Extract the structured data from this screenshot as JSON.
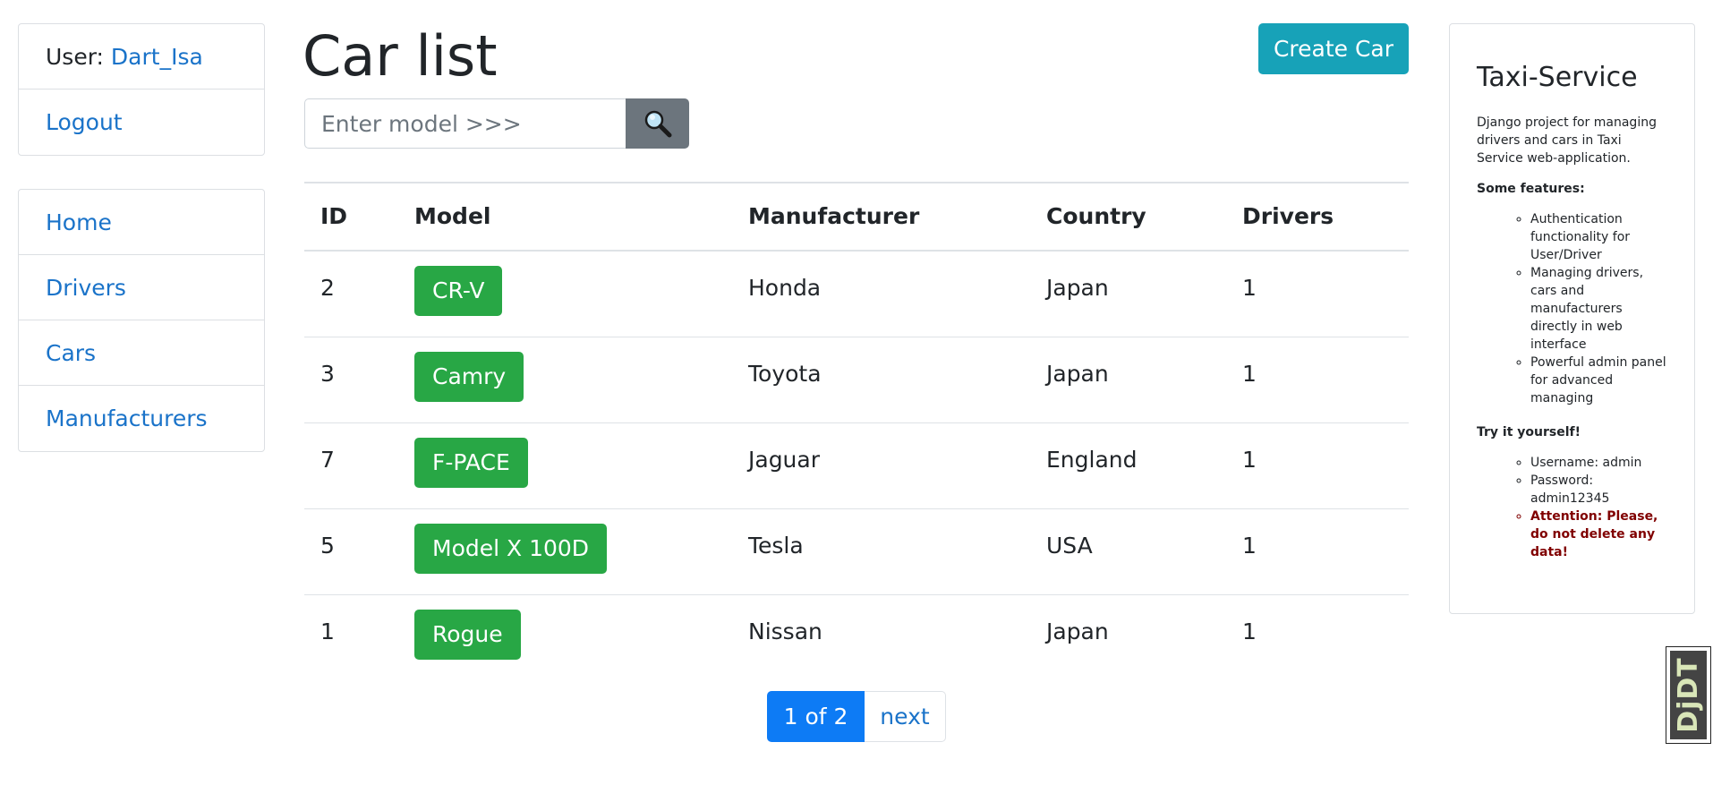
{
  "sidebar": {
    "user_label": "User:",
    "user_name": "Dart_Isa",
    "logout": "Logout",
    "nav": [
      "Home",
      "Drivers",
      "Cars",
      "Manufacturers"
    ]
  },
  "main": {
    "title": "Car list",
    "create_button": "Create Car",
    "search_placeholder": "Enter model >>>",
    "search_icon": "magnifier-icon",
    "table": {
      "headers": [
        "ID",
        "Model",
        "Manufacturer",
        "Country",
        "Drivers"
      ],
      "rows": [
        {
          "id": "2",
          "model": "CR-V",
          "manufacturer": "Honda",
          "country": "Japan",
          "drivers": "1"
        },
        {
          "id": "3",
          "model": "Camry",
          "manufacturer": "Toyota",
          "country": "Japan",
          "drivers": "1"
        },
        {
          "id": "7",
          "model": "F-PACE",
          "manufacturer": "Jaguar",
          "country": "England",
          "drivers": "1"
        },
        {
          "id": "5",
          "model": "Model X 100D",
          "manufacturer": "Tesla",
          "country": "USA",
          "drivers": "1"
        },
        {
          "id": "1",
          "model": "Rogue",
          "manufacturer": "Nissan",
          "country": "Japan",
          "drivers": "1"
        }
      ]
    },
    "pagination": {
      "current": "1 of 2",
      "next": "next"
    }
  },
  "info_card": {
    "title": "Taxi-Service",
    "description": "Django project for managing drivers and cars in Taxi Service web-application.",
    "features_heading": "Some features:",
    "features": [
      "Authentication functionality for User/Driver",
      "Managing drivers, cars and manufacturers directly in web interface",
      "Powerful admin panel for advanced managing"
    ],
    "try_heading": "Try it yourself!",
    "credentials": [
      "Username: admin",
      "Password: admin12345"
    ],
    "attention": "Attention: Please, do not delete any data!"
  },
  "debug_toolbar": {
    "label": "DjDT"
  },
  "colors": {
    "link": "#1a73c9",
    "model_button": "#28a745",
    "create_button": "#17a2b8",
    "search_button": "#6c757d",
    "pager_active": "#0d7bf5",
    "attention": "#800000"
  }
}
